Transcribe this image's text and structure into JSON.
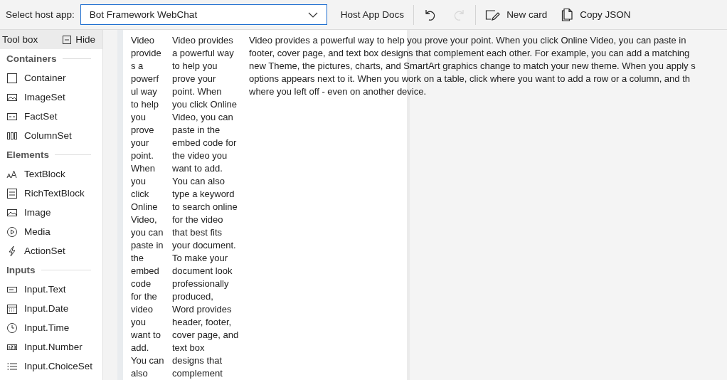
{
  "toolbar": {
    "host_label": "Select host app:",
    "host_select": {
      "value": "Bot Framework WebChat"
    },
    "buttons": [
      {
        "kind": "text",
        "label": "Host App Docs",
        "disabled": false
      },
      {
        "kind": "undo",
        "disabled": false
      },
      {
        "kind": "redo",
        "disabled": true
      },
      {
        "kind": "new",
        "label": "New card",
        "disabled": false
      },
      {
        "kind": "copy",
        "label": "Copy JSON",
        "disabled": false
      }
    ]
  },
  "toolbox": {
    "title": "Tool box",
    "hide_label": "Hide",
    "sections": [
      {
        "title": "Containers",
        "items": [
          "Container",
          "ImageSet",
          "FactSet",
          "ColumnSet"
        ]
      },
      {
        "title": "Elements",
        "items": [
          "TextBlock",
          "RichTextBlock",
          "Image",
          "Media",
          "ActionSet"
        ]
      },
      {
        "title": "Inputs",
        "items": [
          "Input.Text",
          "Input.Date",
          "Input.Time",
          "Input.Number",
          "Input.ChoiceSet"
        ]
      }
    ]
  },
  "card": {
    "columns": [
      {
        "lines": [
          "Video",
          "provide",
          "s a",
          "powerf",
          "ul way",
          "to help",
          "you",
          "prove",
          "your",
          "point.",
          "When",
          "you",
          "click",
          "Online",
          "Video,",
          "you can",
          "paste in",
          "the",
          "embed",
          "code",
          "for the",
          "video",
          "you",
          "want to",
          "add.",
          "You can",
          "also"
        ]
      },
      {
        "lines": [
          "Video provides",
          "a powerful way",
          "to help you",
          "prove your",
          "point. When",
          "you click Online",
          "Video, you can",
          "paste in the",
          "embed code for",
          "the video you",
          "want to add.",
          "You can also",
          "type a keyword",
          "to search online",
          "for the video",
          "that best fits",
          "your document.",
          "To make your",
          "document look",
          "professionally",
          "produced,",
          "Word provides",
          "header, footer,",
          "cover page, and",
          "text box",
          "designs that",
          "complement"
        ]
      },
      {
        "lines": [
          "Video provides a powerful way to help you prove your point. When you click Online Video, you can paste in",
          "footer, cover page, and text box designs that complement each other. For example, you can add a matching",
          "new Theme, the pictures, charts, and SmartArt graphics change to match your new theme. When you apply s",
          "options appears next to it. When you work on a table, click where you want to add a row or a column, and th",
          "where you left off - even on another device."
        ]
      }
    ]
  }
}
